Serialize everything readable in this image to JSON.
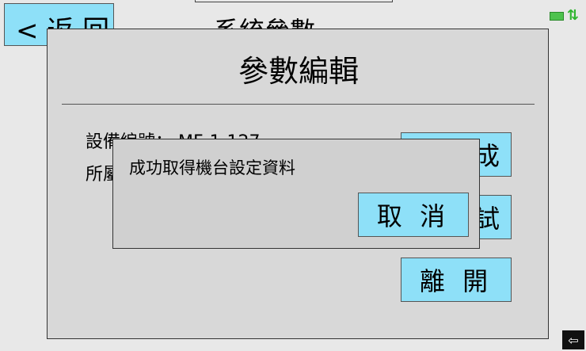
{
  "background": {
    "back_label": "< 返 回",
    "screen_title": "系統參數"
  },
  "status": {
    "battery_icon": "battery-icon",
    "transfer_icon": "transfer-arrows-icon"
  },
  "edit_dialog": {
    "title": "參數編輯",
    "fields": [
      {
        "label": "設備編號：",
        "value": "MF-1-127"
      },
      {
        "label": "所屬",
        "value": ""
      }
    ],
    "button_a_label": "成",
    "button_b_label": "試",
    "leave_label": "離 開"
  },
  "popup": {
    "message": "成功取得機台設定資料",
    "cancel_label": "取 消"
  },
  "corner": {
    "icon": "back-arrow-icon",
    "glyph": "⇦"
  },
  "colors": {
    "button": "#8ee0f8",
    "dialog": "#d8d8d8",
    "popup": "#d0d0d0",
    "status_green": "#4ec24e"
  }
}
